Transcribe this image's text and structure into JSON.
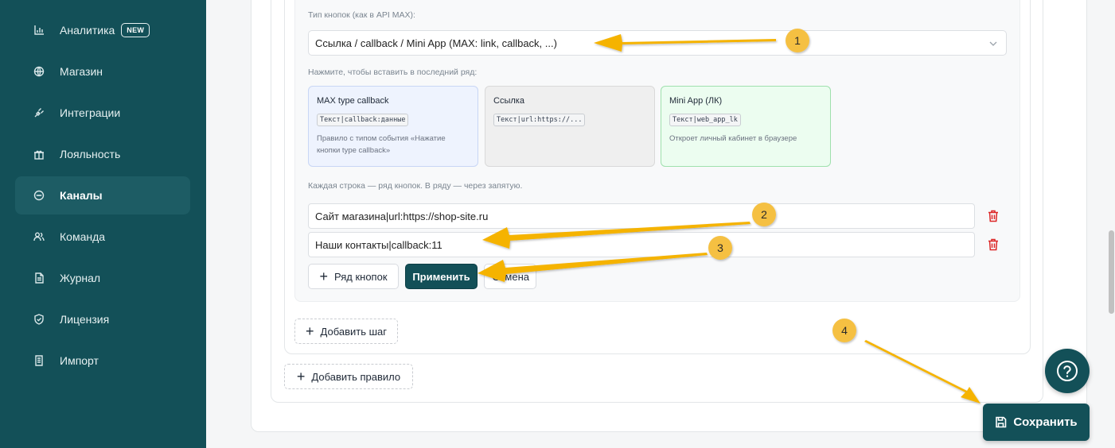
{
  "sidebar": {
    "items": [
      {
        "label": "Аналитика",
        "icon": "bar-chart-icon",
        "badge": "NEW"
      },
      {
        "label": "Магазин",
        "icon": "globe-icon"
      },
      {
        "label": "Интеграции",
        "icon": "plug-icon"
      },
      {
        "label": "Лояльность",
        "icon": "gift-icon"
      },
      {
        "label": "Каналы",
        "icon": "chat-bubble-icon",
        "active": true
      },
      {
        "label": "Команда",
        "icon": "team-icon"
      },
      {
        "label": "Журнал",
        "icon": "document-icon"
      },
      {
        "label": "Лицензия",
        "icon": "shield-check-icon"
      },
      {
        "label": "Импорт",
        "icon": "import-file-icon"
      }
    ]
  },
  "editor": {
    "button_type_label": "Тип кнопок (как в API MAX):",
    "button_type_value": "Ссылка / callback / Mini App (MAX: link, callback, ...)",
    "insert_hint": "Нажмите, чтобы вставить в последний ряд:",
    "templates": [
      {
        "title": "MAX type callback",
        "code": "Текст|callback:данные",
        "desc": "Правило с типом события «Нажатие кнопки type callback»"
      },
      {
        "title": "Ссылка",
        "code": "Текст|url:https://...",
        "desc": ""
      },
      {
        "title": "Mini App (ЛК)",
        "code": "Текст|web_app_lk",
        "desc": "Откроет личный кабинет в браузере"
      }
    ],
    "rows_hint": "Каждая строка — ряд кнопок. В ряду — через запятую.",
    "rows": [
      "Сайт магазина|url:https://shop-site.ru",
      "Наши контакты|callback:11"
    ],
    "add_row_label": "Ряд кнопок",
    "apply_label": "Применить",
    "cancel_label": "Отмена"
  },
  "add_step_label": "Добавить шаг",
  "add_rule_label": "Добавить правило",
  "save_label": "Сохранить",
  "help_icon": "question-circle-icon",
  "annotations": {
    "markers": [
      "1",
      "2",
      "3",
      "4"
    ],
    "arrow_color": "#F5B301"
  },
  "colors": {
    "sidebar_bg": "#135058",
    "primary": "#135058",
    "danger": "#DC2626"
  }
}
